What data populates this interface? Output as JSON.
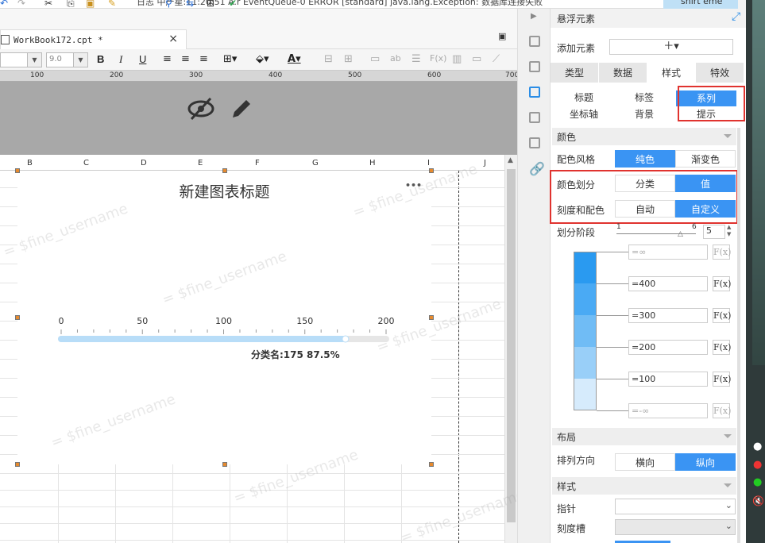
{
  "titlebar": {
    "text": "日志 中产星:11:20:51 A.r EventQueue-0 ERROR [standard] java.lang.Exception: 数据库连接失败",
    "user": "shirt eme"
  },
  "tab": {
    "filename": "WorkBook172.cpt *",
    "close": "×"
  },
  "toolbar": {
    "font_size": "9.0",
    "bold": "B",
    "italic": "I",
    "underline": "U",
    "font_color_glyph": "A"
  },
  "ruler": {
    "marks": [
      "100",
      "200",
      "300",
      "400",
      "500",
      "600",
      "700"
    ]
  },
  "columns": [
    "B",
    "C",
    "D",
    "E",
    "F",
    "G",
    "H",
    "I",
    "J"
  ],
  "watermark": "= $fine_username",
  "chart": {
    "title": "新建图表标题",
    "menu": "•••",
    "label": "分类名:175 87.5%"
  },
  "chart_data": {
    "type": "bar",
    "title": "新建图表标题",
    "orientation": "horizontal-progress",
    "categories": [
      "分类名"
    ],
    "values": [
      175
    ],
    "percent": 87.5,
    "axis_ticks": [
      "0",
      "50",
      "100",
      "150",
      "200"
    ],
    "xlim": [
      0,
      200
    ]
  },
  "panel": {
    "title": "悬浮元素",
    "add_element_label": "添加元素",
    "add_element_value": "＋▾",
    "tabs": [
      {
        "label": "类型",
        "active": false
      },
      {
        "label": "数据",
        "active": false
      },
      {
        "label": "样式",
        "active": true
      },
      {
        "label": "特效",
        "active": false
      }
    ],
    "subtabs": [
      {
        "label": "标题",
        "active": false
      },
      {
        "label": "标签",
        "active": false
      },
      {
        "label": "系列",
        "active": true
      },
      {
        "label": "坐标轴",
        "active": false
      },
      {
        "label": "背景",
        "active": false
      },
      {
        "label": "提示",
        "active": false
      }
    ],
    "color_section": "颜色",
    "color_style_label": "配色风格",
    "color_style_options": [
      "纯色",
      "渐变色"
    ],
    "color_division_label": "颜色划分",
    "color_division_options": [
      "分类",
      "值"
    ],
    "scale_color_label": "刻度和配色",
    "scale_color_options": [
      "自动",
      "自定义"
    ],
    "stage_label": "划分阶段",
    "stage_min": "1",
    "stage_max": "6",
    "stage_value": "5",
    "ranges": [
      {
        "value": "=∞",
        "disabled": true,
        "color": "#2a9af0"
      },
      {
        "value": "=400",
        "disabled": false,
        "color": "#4aaaf4"
      },
      {
        "value": "=300",
        "disabled": false,
        "color": "#70bcf5"
      },
      {
        "value": "=200",
        "disabled": false,
        "color": "#99cff8"
      },
      {
        "value": "=100",
        "disabled": false,
        "color": "#c4e3fb"
      },
      {
        "value": "=-∞",
        "disabled": true,
        "color": "#d9eefc"
      }
    ],
    "fx": "F(x)",
    "layout_section": "布局",
    "direction_label": "排列方向",
    "direction_options": [
      "横向",
      "纵向"
    ],
    "style_section": "样式",
    "pointer_label": "指针",
    "groove_label": "刻度槽"
  },
  "colors": {
    "accent": "#3a94f3",
    "highlight_box": "#e0332f"
  }
}
